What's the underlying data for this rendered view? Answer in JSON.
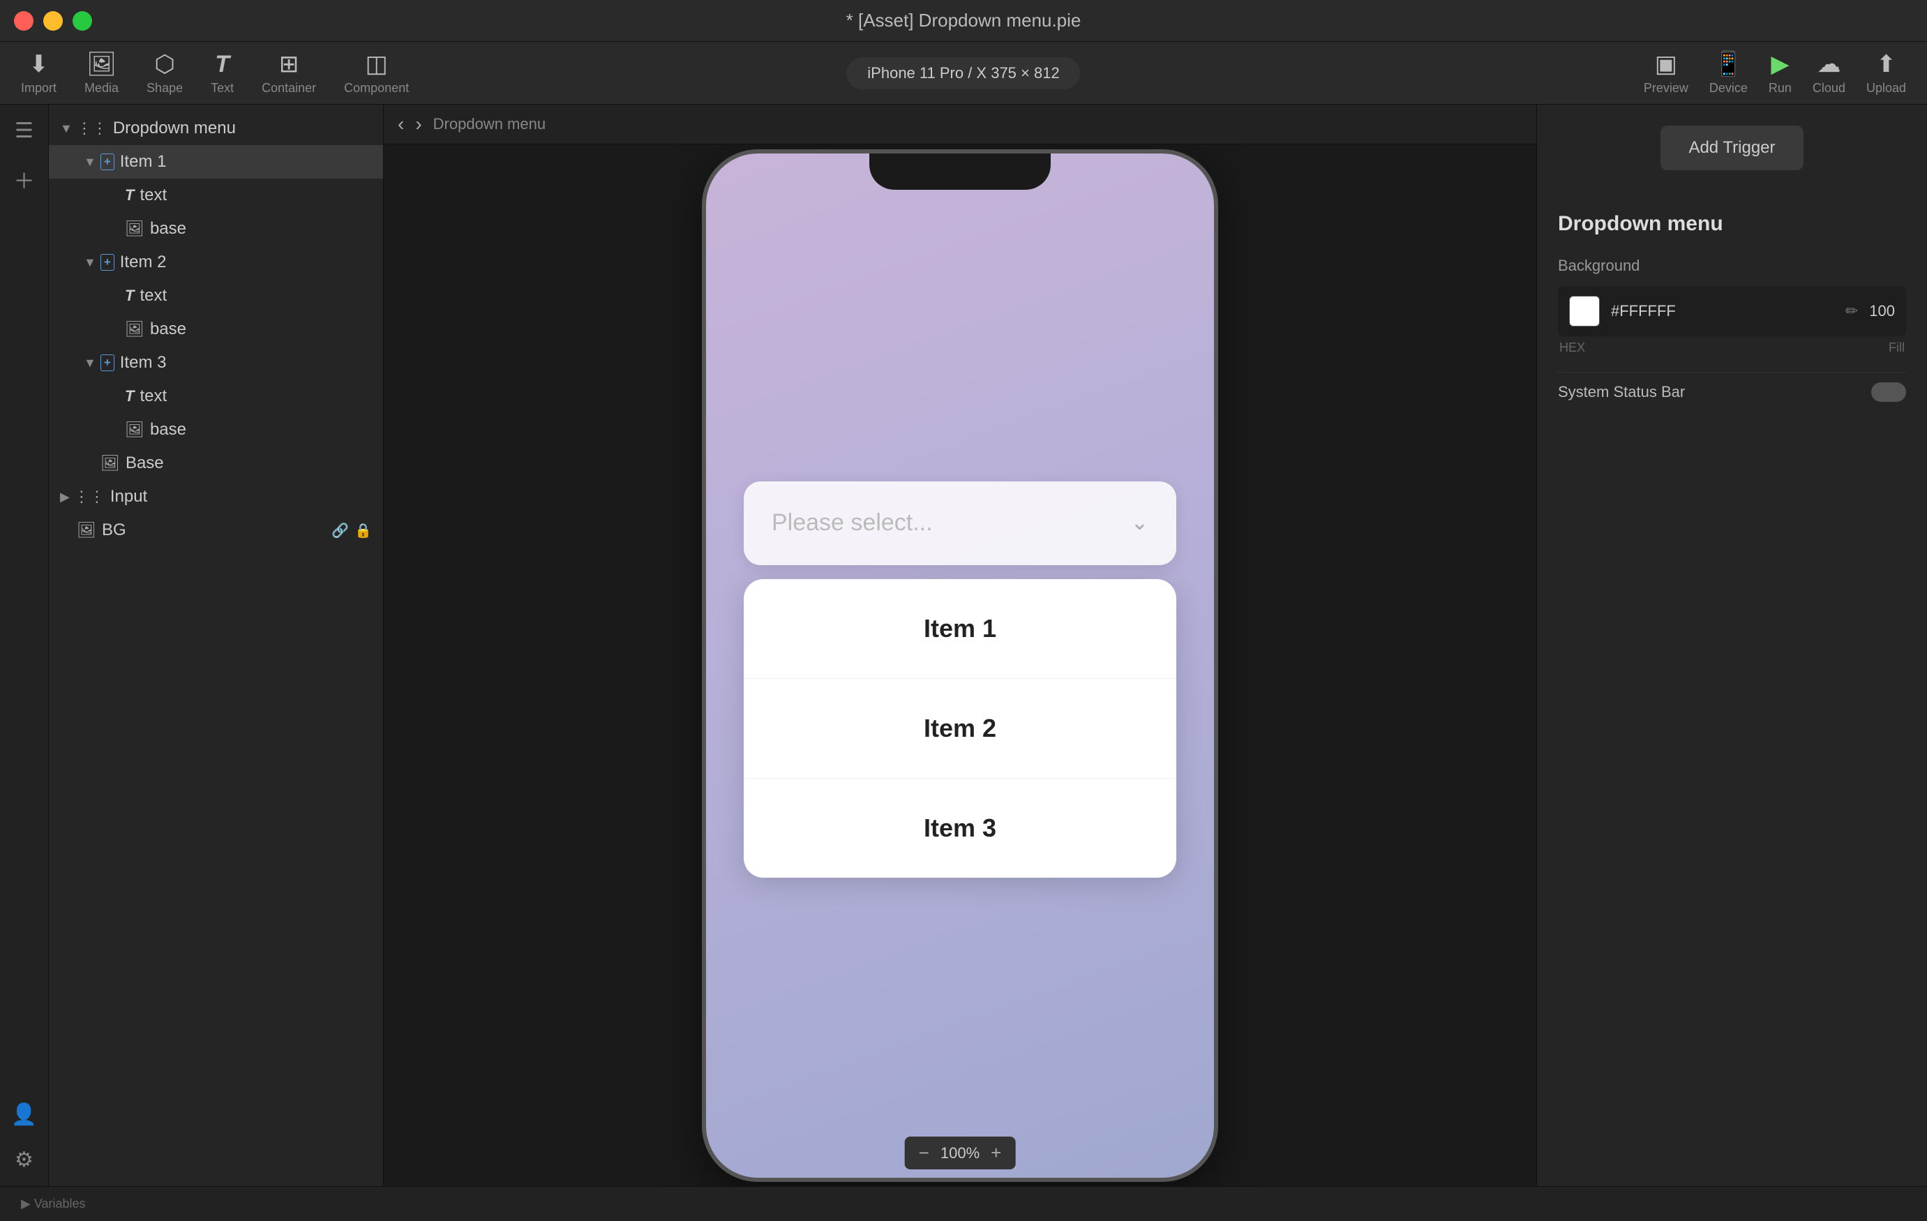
{
  "titlebar": {
    "title": "* [Asset] Dropdown menu.pie"
  },
  "top_toolbar": {
    "items_left": [
      {
        "id": "import",
        "icon": "⬇",
        "label": "Import"
      },
      {
        "id": "media",
        "icon": "🖼",
        "label": "Media"
      },
      {
        "id": "shape",
        "icon": "⬡",
        "label": "Shape"
      },
      {
        "id": "text",
        "icon": "T",
        "label": "Text"
      },
      {
        "id": "container",
        "icon": "⊞",
        "label": "Container"
      },
      {
        "id": "component",
        "icon": "◫",
        "label": "Component"
      }
    ],
    "device_selector": "iPhone 11 Pro / X  375 × 812",
    "items_right": [
      {
        "id": "preview",
        "icon": "▣",
        "label": "Preview"
      },
      {
        "id": "device",
        "icon": "📱",
        "label": "Device"
      },
      {
        "id": "run",
        "icon": "▶",
        "label": "Run"
      },
      {
        "id": "cloud",
        "icon": "☁",
        "label": "Cloud"
      },
      {
        "id": "upload",
        "icon": "⬆",
        "label": "Upload"
      }
    ]
  },
  "left_panel": {
    "layers": [
      {
        "id": "dropdown-menu",
        "name": "Dropdown menu",
        "level": 0,
        "type": "grid",
        "expanded": true,
        "chevron": "▼"
      },
      {
        "id": "item1",
        "name": "Item 1",
        "level": 1,
        "type": "component",
        "expanded": true,
        "chevron": "▼"
      },
      {
        "id": "item1-text",
        "name": "text",
        "level": 2,
        "type": "text",
        "expanded": false,
        "chevron": ""
      },
      {
        "id": "item1-base",
        "name": "base",
        "level": 2,
        "type": "image",
        "expanded": false,
        "chevron": ""
      },
      {
        "id": "item2",
        "name": "Item 2",
        "level": 1,
        "type": "component",
        "expanded": true,
        "chevron": "▼"
      },
      {
        "id": "item2-text",
        "name": "text",
        "level": 2,
        "type": "text",
        "expanded": false,
        "chevron": ""
      },
      {
        "id": "item2-base",
        "name": "base",
        "level": 2,
        "type": "image",
        "expanded": false,
        "chevron": ""
      },
      {
        "id": "item3",
        "name": "Item 3",
        "level": 1,
        "type": "component",
        "expanded": true,
        "chevron": "▼"
      },
      {
        "id": "item3-text",
        "name": "text",
        "level": 2,
        "type": "text",
        "expanded": false,
        "chevron": ""
      },
      {
        "id": "item3-base",
        "name": "base",
        "level": 2,
        "type": "image",
        "expanded": false,
        "chevron": ""
      },
      {
        "id": "base",
        "name": "Base",
        "level": 1,
        "type": "image",
        "expanded": false,
        "chevron": ""
      },
      {
        "id": "input",
        "name": "Input",
        "level": 0,
        "type": "grid",
        "expanded": false,
        "chevron": "▶"
      },
      {
        "id": "bg",
        "name": "BG",
        "level": 0,
        "type": "image",
        "expanded": false,
        "chevron": "",
        "has_lock": true,
        "has_link": true
      }
    ]
  },
  "canvas": {
    "breadcrumb": "Dropdown menu",
    "zoom": "100%",
    "zoom_minus": "−",
    "zoom_plus": "+"
  },
  "phone": {
    "dropdown_placeholder": "Please select...",
    "chevron": "⌄",
    "items": [
      {
        "label": "Item 1"
      },
      {
        "label": "Item 2"
      },
      {
        "label": "Item 3"
      }
    ]
  },
  "right_panel": {
    "title": "Dropdown menu",
    "add_trigger_label": "Add Trigger",
    "background_label": "Background",
    "color_hex": "#FFFFFF",
    "color_hex_label": "HEX",
    "color_fill_value": "100",
    "color_fill_label": "Fill",
    "system_status_bar_label": "System Status Bar"
  },
  "status_bar": {
    "variables_label": "▶  Variables",
    "user_icon": "👤",
    "settings_icon": "⚙"
  }
}
